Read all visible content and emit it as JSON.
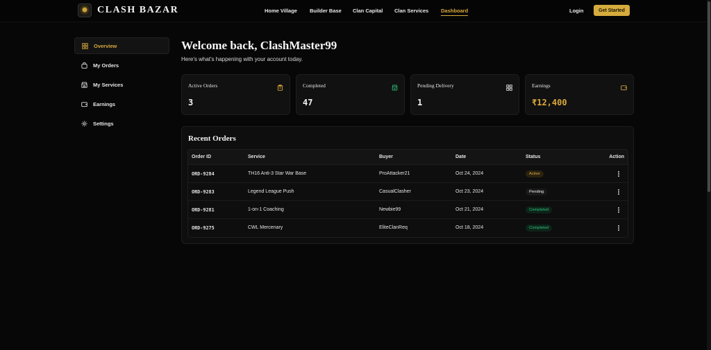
{
  "brand": {
    "name": "CLASH BAZAR"
  },
  "nav": {
    "items": [
      {
        "label": "Home Village"
      },
      {
        "label": "Builder Base"
      },
      {
        "label": "Clan Capital"
      },
      {
        "label": "Clan Services"
      },
      {
        "label": "Dashboard",
        "active": true
      }
    ],
    "login_label": "Login",
    "cta_label": "Get Started"
  },
  "colors": {
    "accent": "#d9a93c",
    "success": "#2fc27a",
    "background": "#070707",
    "card": "#111111"
  },
  "sidebar": {
    "items": [
      {
        "label": "Overview",
        "icon": "grid-icon",
        "active": true
      },
      {
        "label": "My Orders",
        "icon": "bag-icon"
      },
      {
        "label": "My Services",
        "icon": "store-icon"
      },
      {
        "label": "Earnings",
        "icon": "wallet-icon"
      },
      {
        "label": "Settings",
        "icon": "gear-icon"
      }
    ]
  },
  "header": {
    "welcome": "Welcome back, ClashMaster99",
    "subtitle": "Here's what's happening with your account today."
  },
  "stats": [
    {
      "label": "Active Orders",
      "value": "3",
      "icon": "clipboard-icon"
    },
    {
      "label": "Completed",
      "value": "47",
      "icon": "check-bag-icon"
    },
    {
      "label": "Pending Delivery",
      "value": "1",
      "icon": "grid-icon"
    },
    {
      "label": "Earnings",
      "value": "₹12,400",
      "icon": "wallet-icon"
    }
  ],
  "orders": {
    "title": "Recent Orders",
    "columns": [
      "Order ID",
      "Service",
      "Buyer",
      "Date",
      "Status",
      "Action"
    ],
    "rows": [
      {
        "id": "ORD-9284",
        "service": "TH16 Anti-3 Star War Base",
        "buyer": "ProAttacker21",
        "date": "Oct 24, 2024",
        "status": "Active"
      },
      {
        "id": "ORD-9283",
        "service": "Legend League Push",
        "buyer": "CasualClasher",
        "date": "Oct 23, 2024",
        "status": "Pending"
      },
      {
        "id": "ORD-9281",
        "service": "1-on-1 Coaching",
        "buyer": "Newbie99",
        "date": "Oct 21, 2024",
        "status": "Completed"
      },
      {
        "id": "ORD-9275",
        "service": "CWL Mercenary",
        "buyer": "EliteClanReq",
        "date": "Oct 18, 2024",
        "status": "Completed"
      }
    ]
  }
}
